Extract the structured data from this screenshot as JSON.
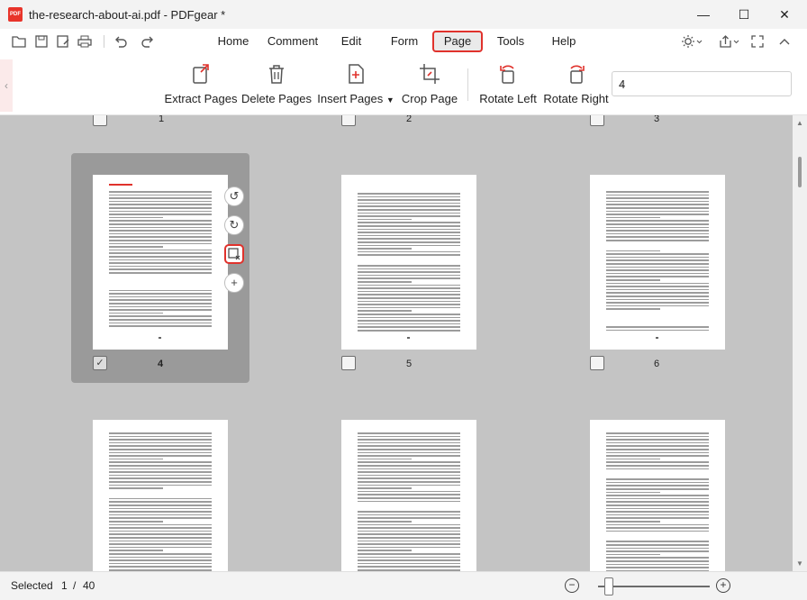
{
  "window": {
    "title": "the-research-about-ai.pdf - PDFgear *",
    "app_icon_text": "PDF"
  },
  "menu": {
    "items": [
      {
        "label": "Home"
      },
      {
        "label": "Comment"
      },
      {
        "label": "Edit"
      },
      {
        "label": "Form"
      },
      {
        "label": "Page"
      },
      {
        "label": "Tools"
      },
      {
        "label": "Help"
      }
    ],
    "active": "Page"
  },
  "ribbon": {
    "extract_pages": "Extract Pages",
    "delete_pages": "Delete Pages",
    "insert_pages": "Insert Pages",
    "crop_page": "Crop Page",
    "rotate_left": "Rotate Left",
    "rotate_right": "Rotate Right",
    "page_select_value": "4"
  },
  "thumbnails": {
    "row1_labels": [
      "1",
      "2",
      "3"
    ],
    "row2_labels": [
      "4",
      "5",
      "6"
    ],
    "selected_page": "4"
  },
  "status": {
    "selected_label": "Selected",
    "current": "1",
    "separator": "/",
    "total": "40"
  },
  "zoom": {
    "level": 0.1
  },
  "colors": {
    "accent_red": "#e0322c",
    "background": "#c4c4c4",
    "selection": "#9a9a9a"
  }
}
